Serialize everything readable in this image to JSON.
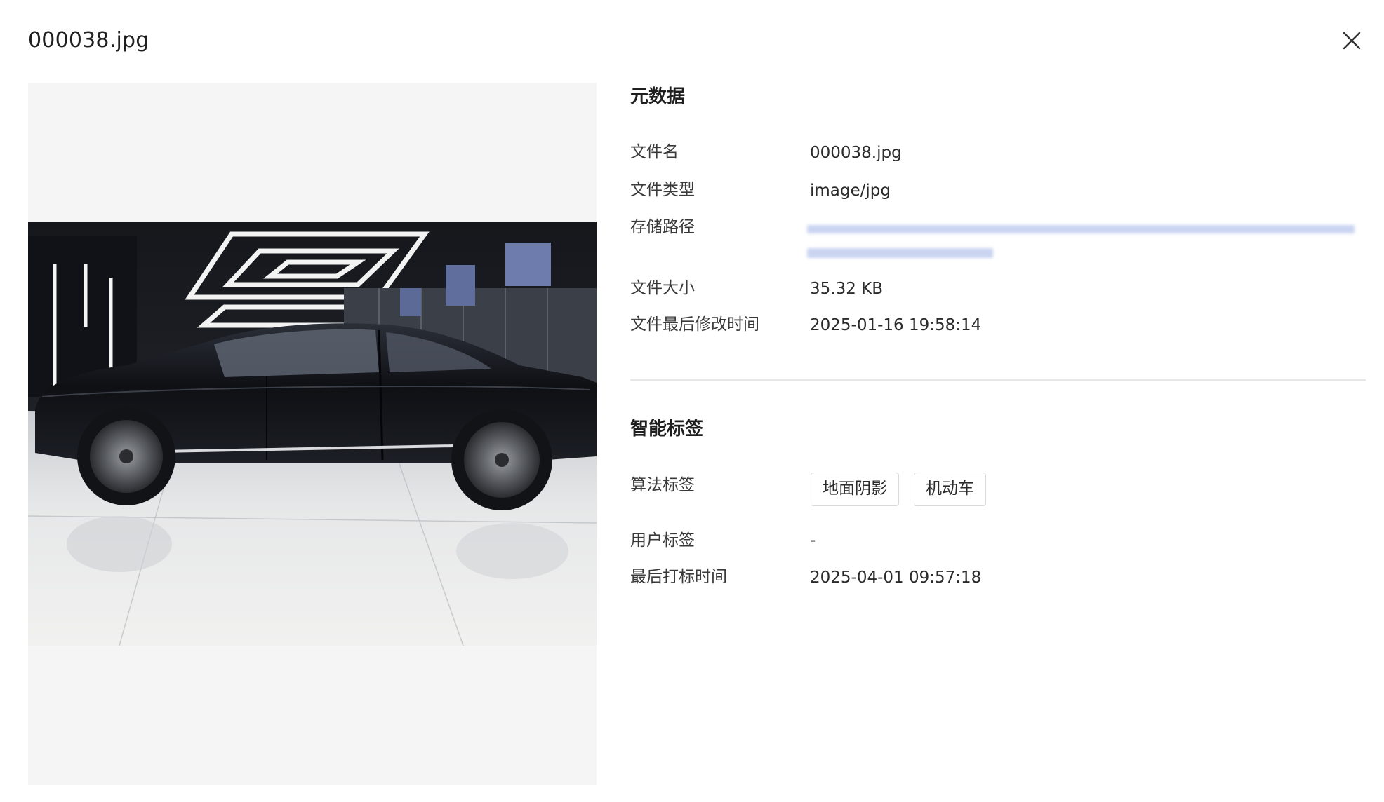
{
  "dialog": {
    "title": "000038.jpg",
    "close_icon": "close-icon"
  },
  "preview": {
    "image_subject": "dark luxury sedan in showroom"
  },
  "metadata": {
    "section_title": "元数据",
    "rows": [
      {
        "label": "文件名",
        "value": "000038.jpg"
      },
      {
        "label": "文件类型",
        "value": "image/jpg"
      },
      {
        "label": "存储路径",
        "value": ""
      },
      {
        "label": "文件大小",
        "value": "35.32 KB"
      },
      {
        "label": "文件最后修改时间",
        "value": "2025-01-16 19:58:14"
      }
    ]
  },
  "smart_tags": {
    "section_title": "智能标签",
    "algorithm_label": "算法标签",
    "algorithm_tags": [
      "地面阴影",
      "机动车"
    ],
    "user_label": "用户标签",
    "user_value": "-",
    "last_tag_time_label": "最后打标时间",
    "last_tag_time_value": "2025-04-01 09:57:18"
  }
}
